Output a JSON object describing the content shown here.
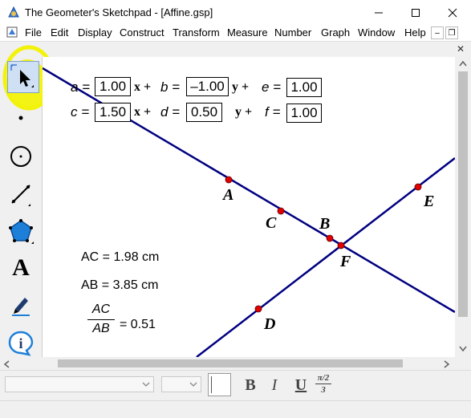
{
  "window": {
    "title": "The Geometer's Sketchpad - [Affine.gsp]",
    "controls": {
      "minimize": "—",
      "maximize": "☐",
      "close": "✕"
    }
  },
  "menu": {
    "items": [
      "File",
      "Edit",
      "Display",
      "Construct",
      "Transform",
      "Measure",
      "Number",
      "Graph",
      "Window",
      "Help"
    ],
    "mini_controls": {
      "minimize": "–",
      "restore": "❐"
    }
  },
  "panel_close": "✕",
  "toolbox": {
    "tools": [
      "selection-arrow-tool",
      "point-tool",
      "compass-tool",
      "straightedge-tool",
      "polygon-tool",
      "text-tool",
      "marker-tool",
      "information-tool"
    ],
    "text_tool_glyph": "A",
    "info_tool_glyph": "i",
    "highlight_color": "#f2f20a"
  },
  "equations": {
    "row1": {
      "a_label": "a =",
      "a_value": "1.00",
      "x_plus": "x +",
      "b_label": "b =",
      "b_value": "–1.00",
      "y_plus": "y +",
      "e_label": "e =",
      "e_value": "1.00"
    },
    "row2": {
      "c_label": "c =",
      "c_value": "1.50",
      "x_plus": "x +",
      "d_label": "d =",
      "d_value": "0.50",
      "y_plus": "y +",
      "f_label": "f =",
      "f_value": "1.00"
    }
  },
  "points": {
    "A": "A",
    "B": "B",
    "C": "C",
    "D": "D",
    "E": "E",
    "F": "F"
  },
  "measurements": {
    "ac": "AC = 1.98 cm",
    "ab": "AB = 3.85 cm",
    "ratio_num": "AC",
    "ratio_den": "AB",
    "ratio_value": "= 0.51"
  },
  "format_bar": {
    "bold": "B",
    "italic": "I",
    "underline": "U",
    "symbol_num": "π/2",
    "symbol_den": "3"
  },
  "colors": {
    "line": "#000080",
    "point": "#e00000",
    "highlight": "#f2f20a"
  }
}
